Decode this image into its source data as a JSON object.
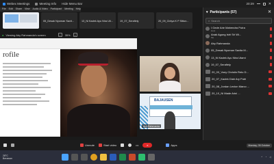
{
  "topbar": {
    "tabs": [
      "Webex Meetings",
      "Meeting Info",
      "Hide Menu Bar"
    ],
    "time": "20:29"
  },
  "menu": [
    "File",
    "Edit",
    "Share",
    "View",
    "Audio & Video",
    "Participant",
    "Meeting",
    "Help"
  ],
  "thumbnails": [
    "",
    "05_Desak Nyoman Savit...",
    "13_Ni Kadek Ayu Nira Uti...",
    "19_07_Serafiely",
    "20_09_Cintya K P Sitton..."
  ],
  "share": {
    "viewing": "Viewing Aby Rahmanda's screen",
    "zoom": "35%"
  },
  "slide": {
    "title": "rofile"
  },
  "tile2": {
    "label": "Aby Rahmanda"
  },
  "participants": {
    "header": "Participants (57)",
    "search_placeholder": "Search",
    "list": [
      {
        "name": "I Gede Arie Mahendra Putra",
        "sub": "Host"
      },
      {
        "name": "Anak Agung Istri Sri Wi...",
        "sub": "Me"
      },
      {
        "name": "Aby Rahmanda",
        "sub": ""
      },
      {
        "name": "05_Desak Nyoman Savita M...",
        "sub": ""
      },
      {
        "name": "13_Ni Kadek Ayu Nira Utami",
        "sub": ""
      },
      {
        "name": "19_07_Serafiely",
        "sub": ""
      },
      {
        "name": "20_03_Vony Christin Reto D...",
        "sub": ""
      },
      {
        "name": "20_07_Kadek Diah Ary Putri",
        "sub": ""
      },
      {
        "name": "20_08_Jordan Lexion Marco ...",
        "sub": ""
      },
      {
        "name": "20_10_Ni Made Arini ...",
        "sub": ""
      }
    ],
    "mute_all": "Mute all",
    "unmute_all": "Unmute all"
  },
  "toolbar": {
    "unmute": "Unmute",
    "start_video": "Start video",
    "apps": "Apps",
    "date": "Monday, 05 October"
  },
  "taskbar": {
    "temp": "28°C",
    "weather": "Berawan"
  }
}
